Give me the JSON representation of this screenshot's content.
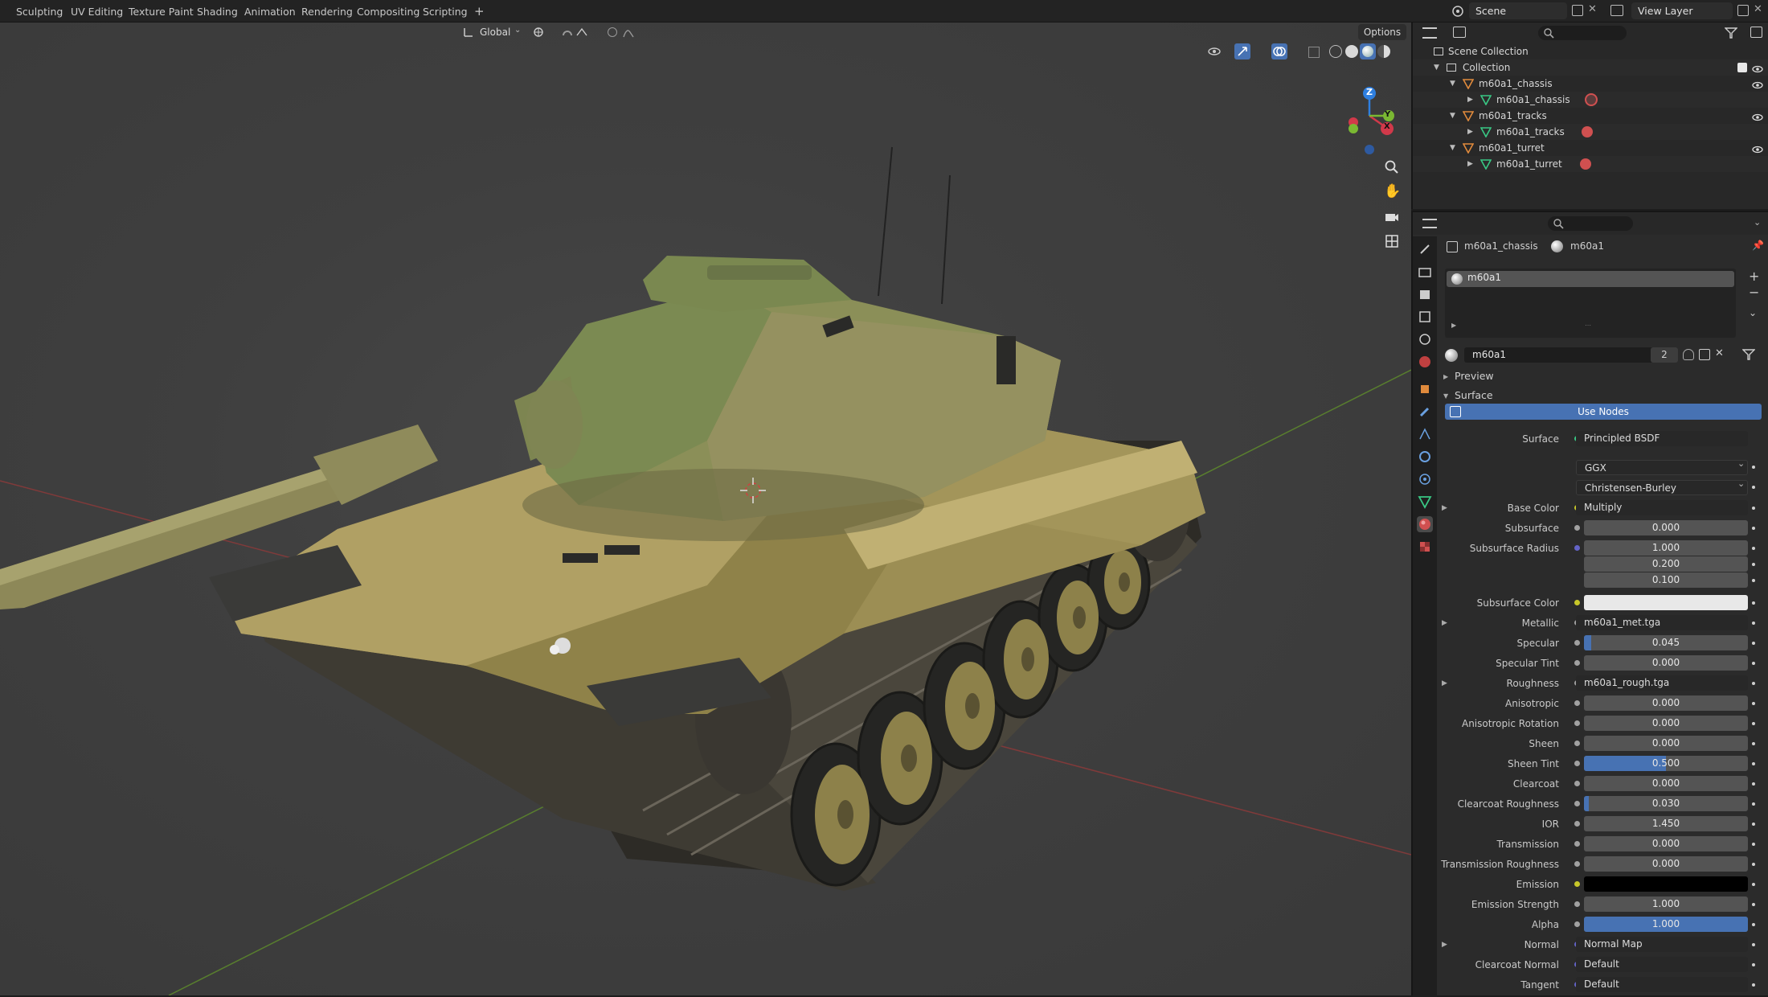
{
  "topbar": {
    "workspaces": [
      "Sculpting",
      "UV Editing",
      "Texture Paint",
      "Shading",
      "Animation",
      "Rendering",
      "Compositing",
      "Scripting"
    ],
    "add_tab": "+",
    "scene": "Scene",
    "view_layer": "View Layer"
  },
  "viewport": {
    "orientation": "Global",
    "options": "Options",
    "gizmo_axes": {
      "z": "Z",
      "y": "Y",
      "x": "X"
    }
  },
  "outliner": {
    "root": "Scene Collection",
    "collection": "Collection",
    "objects": [
      {
        "name": "m60a1_chassis",
        "mesh": "m60a1_chassis"
      },
      {
        "name": "m60a1_tracks",
        "mesh": "m60a1_tracks"
      },
      {
        "name": "m60a1_turret",
        "mesh": "m60a1_turret"
      }
    ]
  },
  "properties": {
    "breadcrumb_object": "m60a1_chassis",
    "breadcrumb_material": "m60a1",
    "slot_name": "m60a1",
    "material_name": "m60a1",
    "user_count": "2",
    "panels": {
      "preview": "Preview",
      "surface": "Surface"
    },
    "use_nodes": "Use Nodes",
    "surface_label": "Surface",
    "surface_shader": "Principled BSDF",
    "distribution": "GGX",
    "subsurface_method": "Christensen-Burley",
    "inputs": {
      "base_color": {
        "label": "Base Color",
        "value": "Multiply"
      },
      "subsurface": {
        "label": "Subsurface",
        "value": "0.000"
      },
      "subsurface_radius": {
        "label": "Subsurface Radius",
        "values": [
          "1.000",
          "0.200",
          "0.100"
        ]
      },
      "subsurface_color": {
        "label": "Subsurface Color",
        "color": "#e8e8e8"
      },
      "metallic": {
        "label": "Metallic",
        "value": "m60a1_met.tga"
      },
      "specular": {
        "label": "Specular",
        "value": "0.045",
        "fill": 0.045
      },
      "specular_tint": {
        "label": "Specular Tint",
        "value": "0.000"
      },
      "roughness": {
        "label": "Roughness",
        "value": "m60a1_rough.tga"
      },
      "anisotropic": {
        "label": "Anisotropic",
        "value": "0.000"
      },
      "anisotropic_rotation": {
        "label": "Anisotropic Rotation",
        "value": "0.000"
      },
      "sheen": {
        "label": "Sheen",
        "value": "0.000"
      },
      "sheen_tint": {
        "label": "Sheen Tint",
        "value": "0.500",
        "fill": 0.5
      },
      "clearcoat": {
        "label": "Clearcoat",
        "value": "0.000"
      },
      "clearcoat_roughness": {
        "label": "Clearcoat Roughness",
        "value": "0.030",
        "fill": 0.03
      },
      "ior": {
        "label": "IOR",
        "value": "1.450"
      },
      "transmission": {
        "label": "Transmission",
        "value": "0.000"
      },
      "transmission_roughness": {
        "label": "Transmission Roughness",
        "value": "0.000"
      },
      "emission": {
        "label": "Emission",
        "color": "#000000"
      },
      "emission_strength": {
        "label": "Emission Strength",
        "value": "1.000"
      },
      "alpha": {
        "label": "Alpha",
        "value": "1.000",
        "fill": 1.0
      },
      "normal": {
        "label": "Normal",
        "value": "Normal Map"
      },
      "clearcoat_normal": {
        "label": "Clearcoat Normal",
        "value": "Default"
      },
      "tangent": {
        "label": "Tangent",
        "value": "Default"
      }
    }
  },
  "colors": {
    "accent": "#4772b3",
    "socket_yellow": "#c7c729",
    "socket_grey": "#a1a1a1",
    "socket_purple": "#6363c7",
    "socket_green": "#39c884",
    "axis_x": "#d1394a",
    "axis_y": "#7ab832",
    "axis_z": "#2e7fe0"
  }
}
